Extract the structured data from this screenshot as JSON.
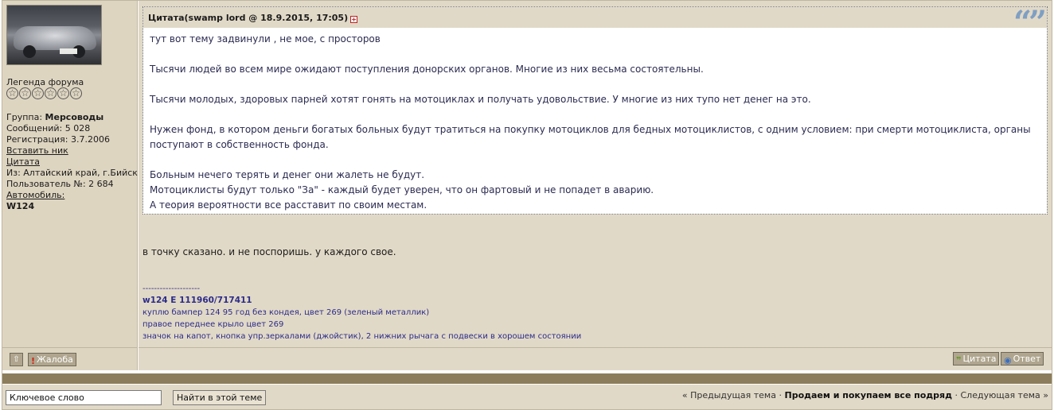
{
  "user": {
    "rank": "Легенда форума",
    "stars": [
      "☆",
      "☆",
      "☆",
      "☆",
      "☆",
      "☆"
    ],
    "group_label": "Группа:",
    "group_value": "Мерсоводы",
    "messages": "Сообщений: 5 028",
    "registration": "Регистрация: 3.7.2006",
    "insert_nick": "Вставить ник",
    "quote_link": "Цитата",
    "location": "Из: Алтайский край, г.Бийск",
    "user_number": "Пользователь №: 2 684",
    "car_label": "Автомобиль:",
    "car_value": "W124"
  },
  "quote": {
    "header": "Цитата(swamp lord @ 18.9.2015, 17:05)",
    "quote_mark": "“”",
    "lines": [
      "тут вот тему задвинули , не мое, с просторов",
      "Тысячи людей во всем мире ожидают поступления донорских органов. Многие из них весьма состоятельны.",
      "Тысячи молодых, здоровых парней хотят гонять на мотоциклах и получать удовольствие. У многие из них тупо нет денег на это.",
      "Нужен фонд, в котором деньги богатых больных будут тратиться на покупку мотоциклов для бедных мотоциклистов, с одним условием: при смерти мотоциклиста, органы поступают в собственность фонда.",
      "Больным нечего терять и денег они жалеть не будут.",
      "Мотоциклисты будут только \"За\" - каждый будет уверен, что он фартовый и не попадет в аварию.",
      "А теория вероятности все расставит по своим местам."
    ]
  },
  "post": {
    "text": "в точку сказано. и не поспоришь. у каждого свое."
  },
  "signature": {
    "separator": "--------------------",
    "title": "w124 E 111960/717411",
    "lines": [
      "куплю бампер 124 95 год без кондея, цвет 269 (зеленый металлик)",
      "правое переднее крыло цвет 269",
      "значок на капот, кнопка упр.зеркалами (джойстик), 2 нижних рычага с подвески в хорошем состоянии"
    ]
  },
  "buttons": {
    "up_icon": "⇧",
    "complain": "Жалоба",
    "quote": "Цитата",
    "reply": "Ответ"
  },
  "footer": {
    "search_value": "Ключевое слово",
    "search_button": "Найти в этой теме",
    "prev_topic": "« Предыдущая тема",
    "separator": "·",
    "current_topic": "Продаем и покупаем все подряд",
    "next_topic": "Следующая тема »"
  },
  "colors": {
    "panel": "#e1d9c7",
    "left_panel": "#ded5c1",
    "strip": "#8c7e5c",
    "quote_text": "#2b2b52",
    "signature": "#2b2b8a"
  }
}
